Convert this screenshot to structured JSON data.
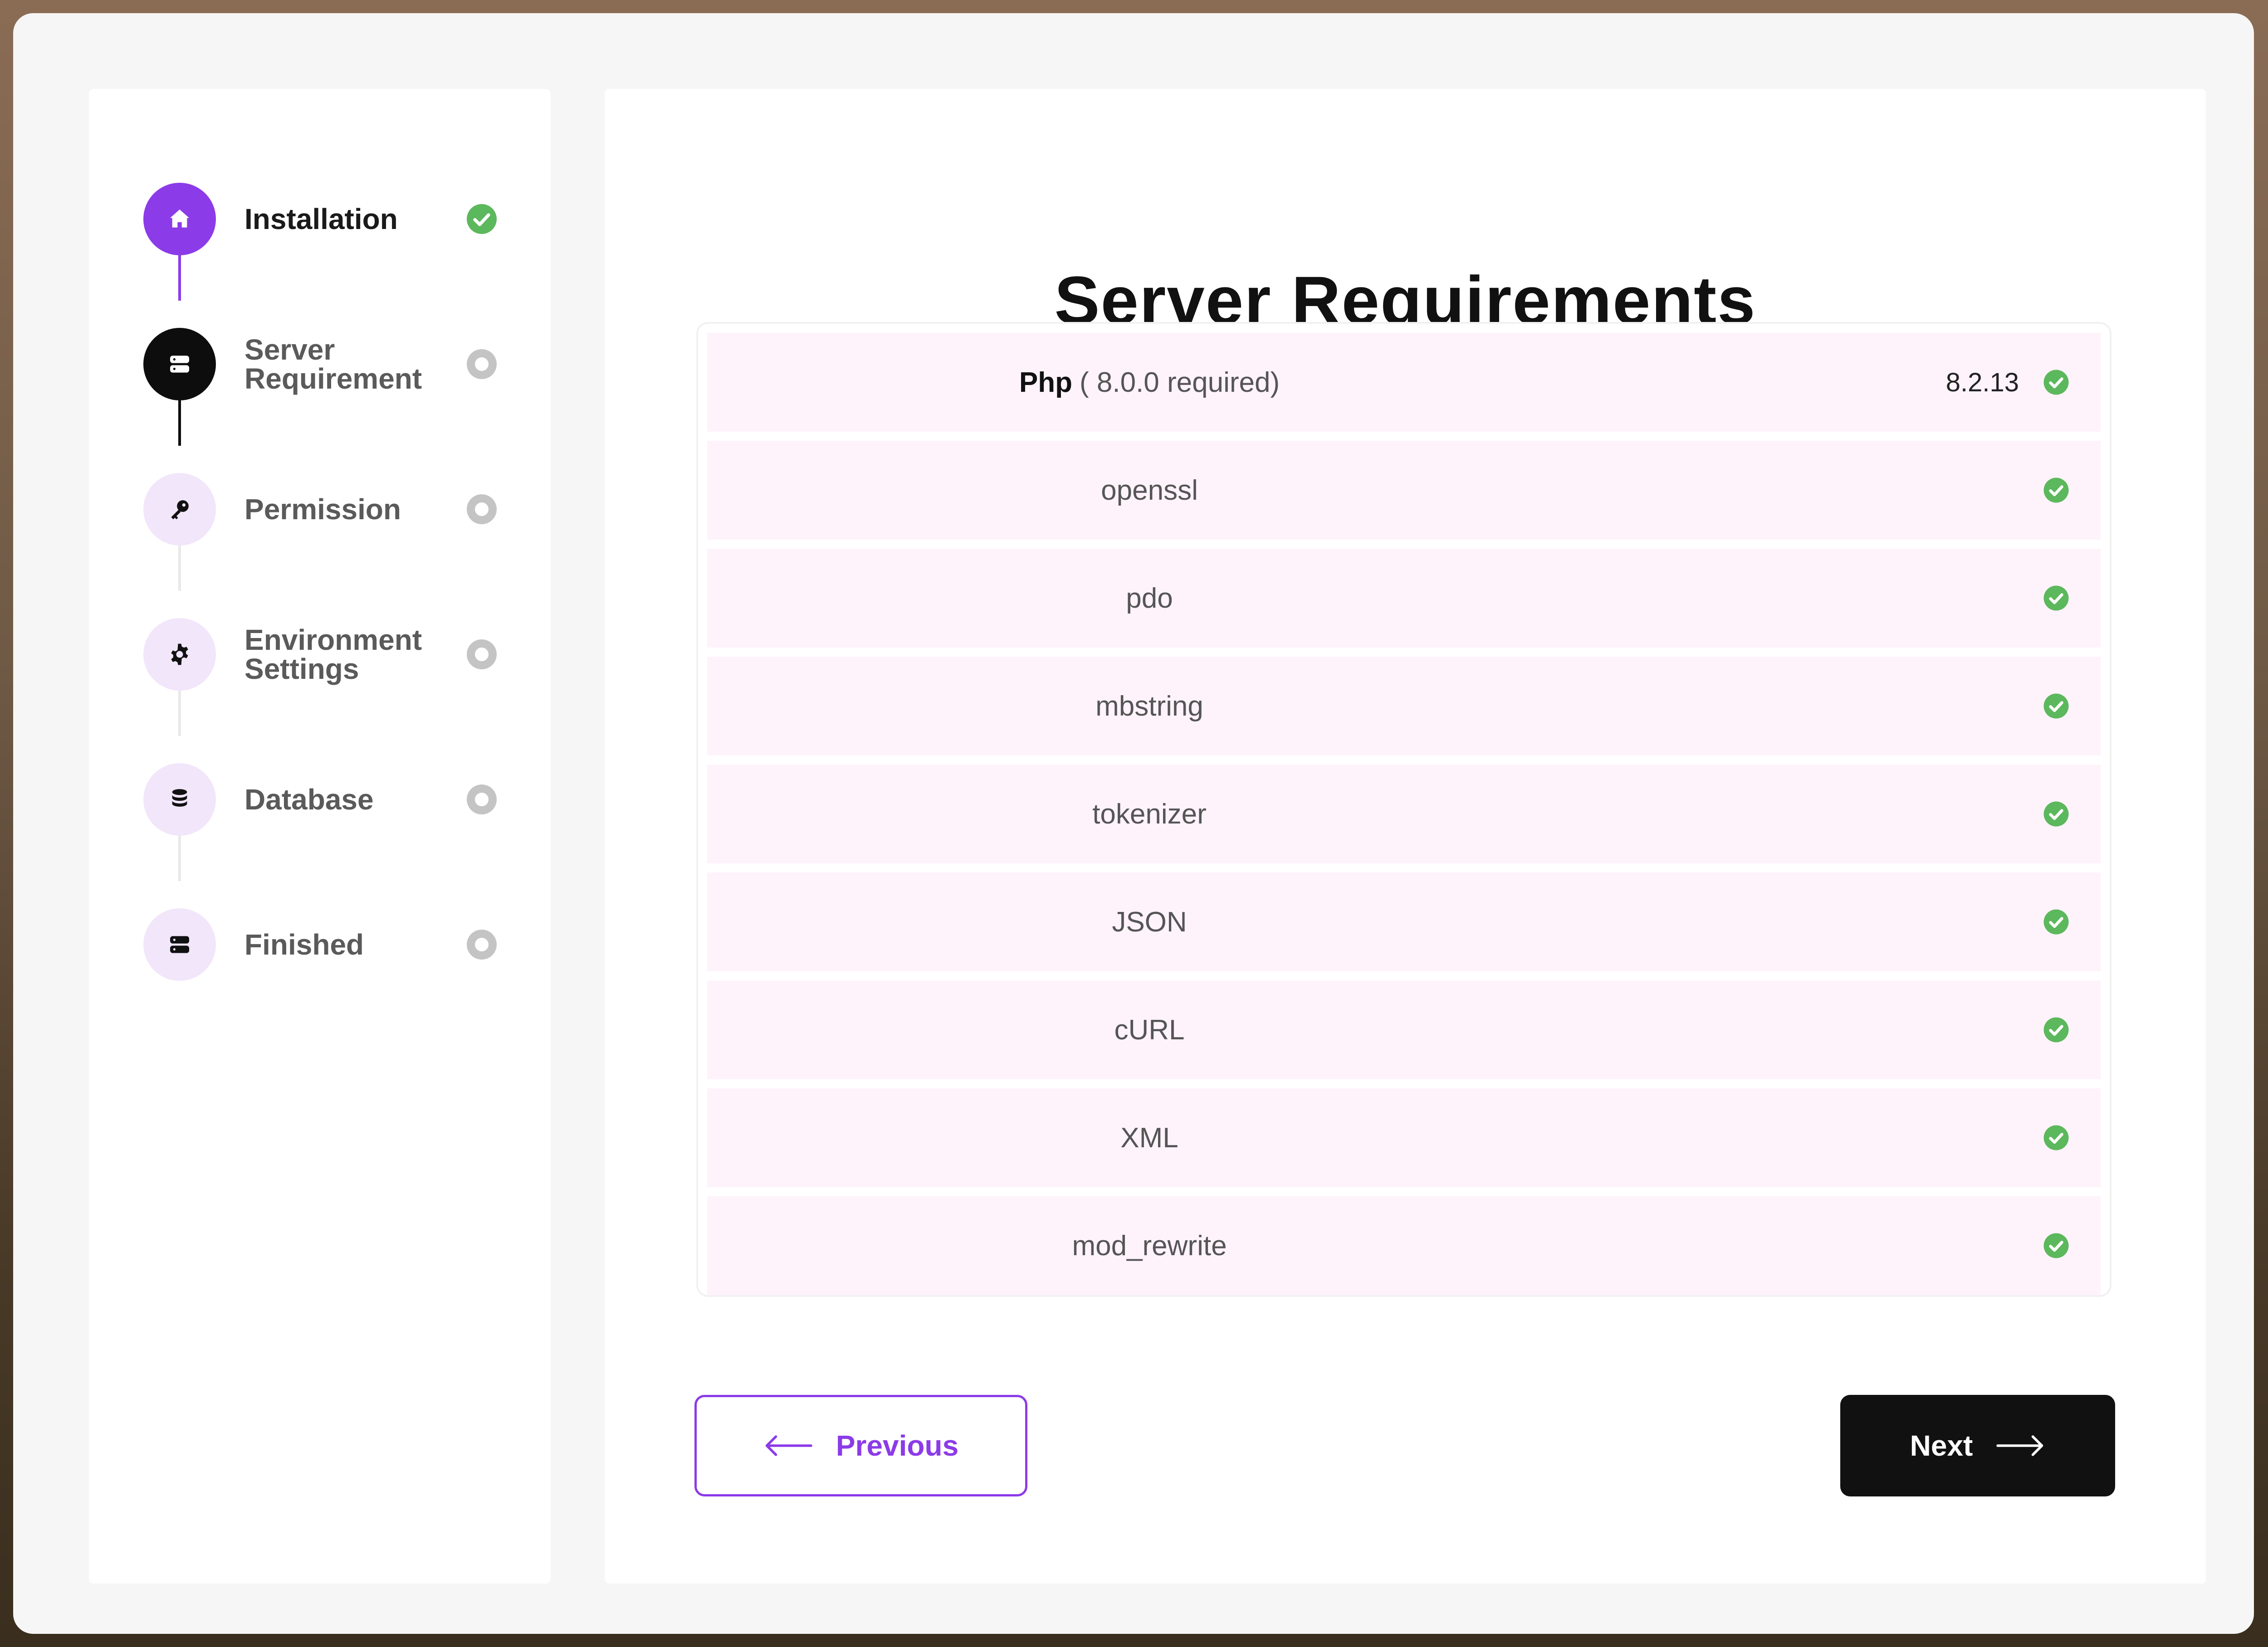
{
  "steps": [
    {
      "label": "Installation",
      "state": "done",
      "icon": "home-icon"
    },
    {
      "label": "Server\nRequirement",
      "state": "current",
      "icon": "server-icon"
    },
    {
      "label": "Permission",
      "state": "pending",
      "icon": "key-icon"
    },
    {
      "label": "Environment\nSettings",
      "state": "pending",
      "icon": "gear-icon"
    },
    {
      "label": "Database",
      "state": "pending",
      "icon": "database-icon"
    },
    {
      "label": "Finished",
      "state": "pending",
      "icon": "server-icon"
    }
  ],
  "main": {
    "title": "Server Requirements",
    "php": {
      "name": "Php",
      "requirement": "( 8.0.0 required)",
      "version": "8.2.13"
    },
    "requirements": [
      "openssl",
      "pdo",
      "mbstring",
      "tokenizer",
      "JSON",
      "cURL",
      "XML",
      "mod_rewrite"
    ]
  },
  "buttons": {
    "previous": "Previous",
    "next": "Next"
  },
  "colors": {
    "accent": "#8c3be8",
    "success": "#5cb85c",
    "pending": "#c4c4c4",
    "row_bg": "#fff3fb"
  }
}
